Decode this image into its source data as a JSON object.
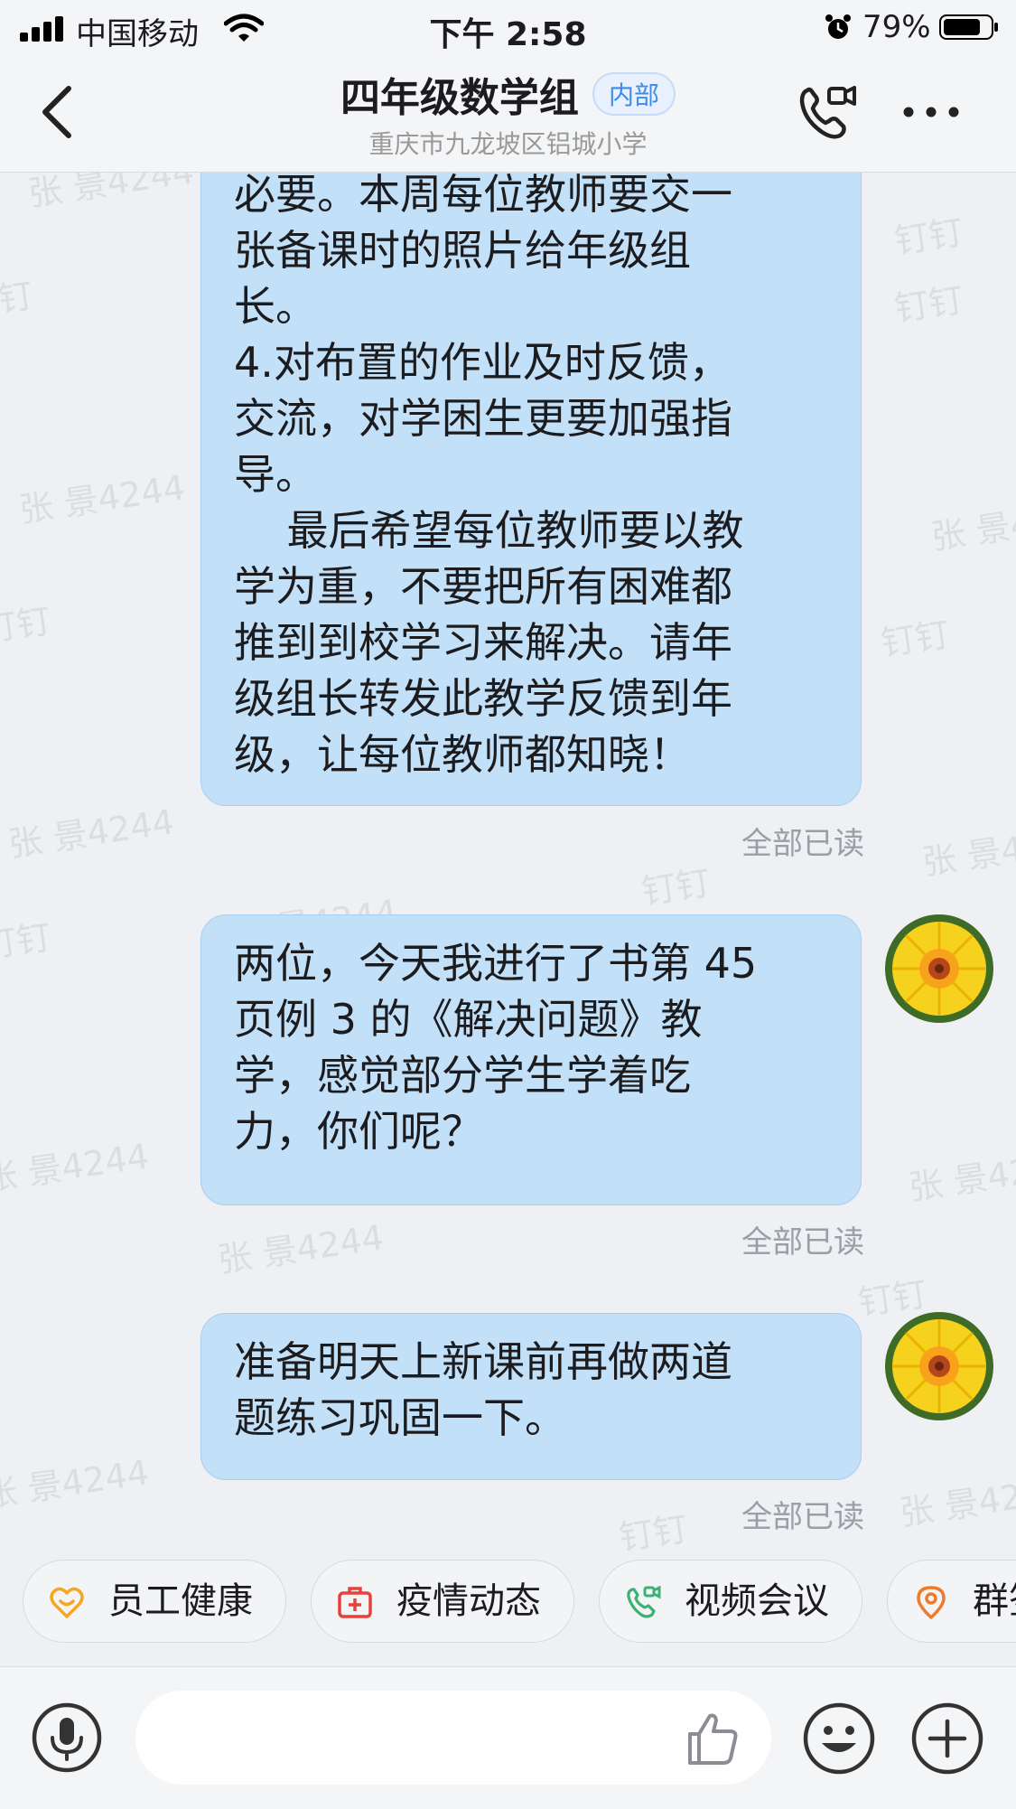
{
  "status_bar": {
    "carrier": "中国移动",
    "time": "下午 2:58",
    "battery": "79%"
  },
  "header": {
    "title": "四年级数学组",
    "badge": "内部",
    "subtitle": "重庆市九龙坡区铝城小学"
  },
  "watermarks": [
    "张 景4244",
    "钉钉"
  ],
  "messages": [
    {
      "text": "必要。本周每位教师要交一\n张备课时的照片给年级组\n长。\n4.对布置的作业及时反馈，\n交流，对学困生更要加强指\n导。\n    最后希望每位教师要以教\n学为重，不要把所有困难都\n推到到校学习来解决。请年\n级组长转发此教学反馈到年\n级，让每位教师都知晓！",
      "status": "全部已读"
    },
    {
      "text": "两位，今天我进行了书第 45\n页例 3 的《解决问题》教\n学，感觉部分学生学着吃\n力，你们呢？",
      "status": "全部已读"
    },
    {
      "text": "准备明天上新课前再做两道\n题练习巩固一下。",
      "status": "全部已读"
    }
  ],
  "shortcuts": [
    {
      "label": "员工健康",
      "icon": "heart-smile-icon",
      "color": "#f5a623"
    },
    {
      "label": "疫情动态",
      "icon": "medical-kit-icon",
      "color": "#e8413b"
    },
    {
      "label": "视频会议",
      "icon": "video-call-icon",
      "color": "#3bb273"
    },
    {
      "label": "群签到",
      "icon": "location-pin-icon",
      "color": "#f07a2a"
    }
  ],
  "input": {
    "placeholder": ""
  },
  "colors": {
    "bubble": "#c3e0f9",
    "background": "#eef0f3",
    "badge_text": "#3f8ce8"
  }
}
